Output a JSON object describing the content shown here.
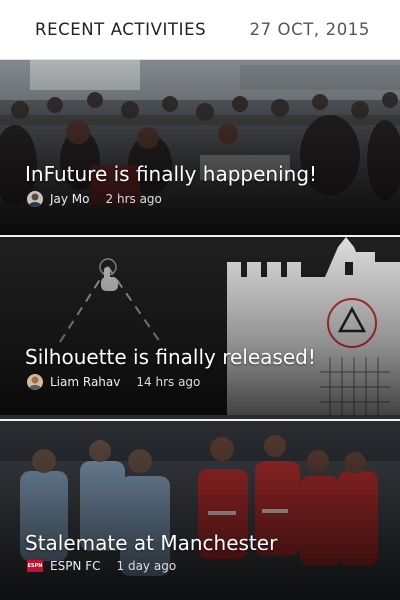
{
  "header": {
    "title": "RECENT ACTIVITIES",
    "date": "27 OCT, 2015"
  },
  "activities": [
    {
      "title": "InFuture is finally happening!",
      "author": "Jay Mo",
      "time": "2 hrs ago",
      "avatar_icon": "user-avatar"
    },
    {
      "title": "Silhouette is finally released!",
      "author": "Liam Rahav",
      "time": "14 hrs ago",
      "avatar_icon": "user-avatar"
    },
    {
      "title": "Stalemate at Manchester",
      "author": "ESPN FC",
      "time": "1 day ago",
      "avatar_icon": "espn-logo",
      "logo_text": "ESPN"
    }
  ]
}
